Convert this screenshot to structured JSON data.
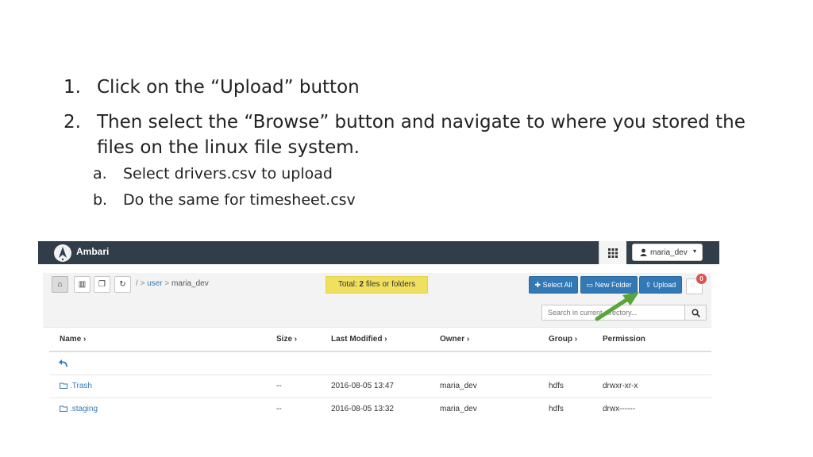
{
  "instructions": {
    "steps": [
      {
        "num": "1.",
        "text": "Click on the “Upload” button"
      },
      {
        "num": "2.",
        "text": "Then select the “Browse” button and navigate to where you stored the  files on the linux file system."
      }
    ],
    "substeps": [
      {
        "num": "a.",
        "text": "Select drivers.csv to upload"
      },
      {
        "num": "b.",
        "text": "Do the same for timesheet.csv"
      }
    ]
  },
  "app": {
    "brand": "Ambari",
    "user_menu_label": "maria_dev",
    "colors": {
      "topbar": "#313d48",
      "primary": "#3379b5",
      "total_badge": "#f0e060",
      "arrow": "#5aa43c",
      "notify": "#d9534f"
    }
  },
  "toolbar": {
    "breadcrumb": {
      "root": "/",
      "sep": ">",
      "parts": [
        "user",
        "maria_dev"
      ]
    },
    "total_prefix": "Total: ",
    "total_count": "2",
    "total_suffix": " files or folders",
    "select_all_label": "Select All",
    "new_folder_label": "New Folder",
    "upload_label": "Upload",
    "notification_count": "0",
    "search_placeholder": "Search in current directory...",
    "icons": [
      "home-icon",
      "trash-icon",
      "copy-icon",
      "refresh-icon",
      "plus-icon",
      "folder-icon",
      "upload-icon",
      "comment-icon",
      "search-icon"
    ]
  },
  "table": {
    "headers": [
      "Name",
      "Size",
      "Last Modified",
      "Owner",
      "Group",
      "Permission"
    ],
    "rows": [
      {
        "name": ".Trash",
        "size": "--",
        "modified": "2016-08-05 13:47",
        "owner": "maria_dev",
        "group": "hdfs",
        "permission": "drwxr-xr-x"
      },
      {
        "name": ".staging",
        "size": "--",
        "modified": "2016-08-05 13:32",
        "owner": "maria_dev",
        "group": "hdfs",
        "permission": "drwx------"
      }
    ]
  }
}
